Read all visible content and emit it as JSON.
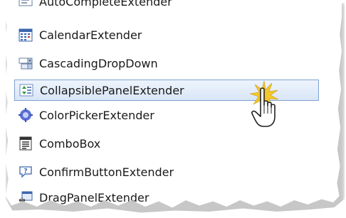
{
  "toolbox": {
    "items": [
      {
        "label": "AutoCompleteExtender",
        "icon": "autocomplete-icon"
      },
      {
        "label": "CalendarExtender",
        "icon": "calendar-icon"
      },
      {
        "label": "CascadingDropDown",
        "icon": "dropdown-icon"
      },
      {
        "label": "CollapsiblePanelExtender",
        "icon": "collapsible-panel-icon",
        "selected": true
      },
      {
        "label": "ColorPickerExtender",
        "icon": "color-picker-icon"
      },
      {
        "label": "ComboBox",
        "icon": "combobox-icon"
      },
      {
        "label": "ConfirmButtonExtender",
        "icon": "confirm-button-icon"
      },
      {
        "label": "DragPanelExtender",
        "icon": "drag-panel-icon"
      }
    ]
  },
  "colors": {
    "selection_border": "#7da2ce",
    "selection_fill": "#dce8f8",
    "text": "#1a1a1a"
  }
}
